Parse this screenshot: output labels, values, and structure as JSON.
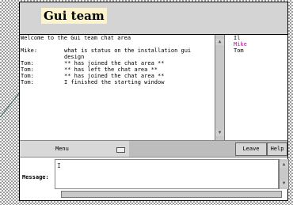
{
  "window": {
    "title": "Gui team"
  },
  "chat": {
    "welcome": "Welcome to the Gui team chat area",
    "lines": [
      {
        "speaker": "Mike:",
        "text": "what is status on the installation gui design"
      },
      {
        "speaker": "Tom:",
        "text": "** has joined the chat area **"
      },
      {
        "speaker": "Tom:",
        "text": "** has left the chat area **"
      },
      {
        "speaker": "Tom:",
        "text": "** has joined the chat area **"
      },
      {
        "speaker": "Tom:",
        "text": "I finished the starting window"
      }
    ]
  },
  "users": [
    {
      "name": "Il",
      "color": "#000000"
    },
    {
      "name": "Mike",
      "color": "#b0109a"
    },
    {
      "name": "Tom",
      "color": "#000000"
    }
  ],
  "toolbar": {
    "menu_label": "Menu",
    "leave_label": "Leave",
    "help_label": "Help"
  },
  "message": {
    "label": "Message:",
    "value": ""
  }
}
